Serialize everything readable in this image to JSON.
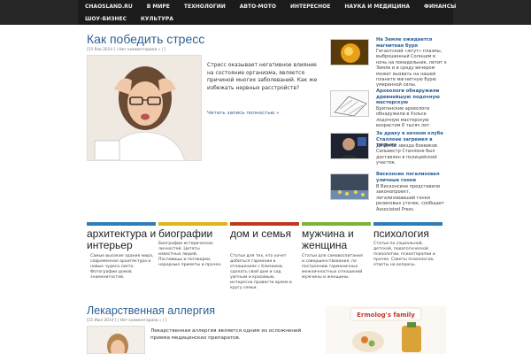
{
  "nav": {
    "row1": [
      "CHAOSLAND.RU",
      "В МИРЕ",
      "ТЕХНОЛОГИИ",
      "АВТО-МОТО",
      "ИНТЕРЕСНОЕ",
      "НАУКА И МЕДИЦИНА",
      "ФИНАНСЫ"
    ],
    "row2": [
      "ШОУ-БИЗНЕС",
      "КУЛЬТУРА"
    ]
  },
  "featured": {
    "title": "Как победить стресс",
    "meta": "[15 Янв 2014 ] | Нет комментариев » | ]",
    "excerpt": "Стресс оказывает негативное влияние на состояние организма, является причиной многих заболеваний. Как же избежать нервных расстройств?",
    "readmore": "Читать запись полностью »"
  },
  "news": [
    {
      "title": "На Земле ожидается магнитная буря",
      "text": "Гигантский «жгут» плазмы, выброшенный Солнцем в ночь на понедельник, летит к Земле и в среду вечером может вызвать на нашей планете магнитную бурю умеренной силы."
    },
    {
      "title": "Археологи обнаружили древнейшую лодочную мастерскую",
      "text": "Британские археологи обнаружили в Уэльсе лодочную мастерскую возрастом 6 тысяч лет."
    },
    {
      "title": "За драку в ночном клубе Сталлоне загремел в тюрьму",
      "text": "Ди Джей звезда боевиков Сильвестр Сталлоне был доставлен в полицейский участок."
    },
    {
      "title": "Висконсин легализовал уличные гонки",
      "text": "В Висконсине представили законопроект, легализовавший гонки резиновых уточек, сообщает Associated Press."
    }
  ],
  "categories": [
    {
      "title": "архитектура и интерьер",
      "text": "Самые высокие здания мира, современная архитектура и новые чудеса света. Фотографии домов знаменитостей.",
      "color": "#2e7db8"
    },
    {
      "title": "биографии",
      "text": "Биографии исторических личностей. Цитаты известных людей. Пословицы и поговорки, народные приметы и прочее.",
      "color": "#e2b31a"
    },
    {
      "title": "дом и семья",
      "text": "Статьи для тех, кто хочет добиться гармонии в отношениях с близкими, сделать свой дом и сад уютным и красивым, интересно провести время в кругу семьи.",
      "color": "#c0391f"
    },
    {
      "title": "мужчина и женщина",
      "text": "Статьи для самовоспитания и совершенствования, по построению гармоничных межличностных отношений мужчины и женщины.",
      "color": "#7bb338"
    },
    {
      "title": "психология",
      "text": "Статьи по социальной, детской, педагогической психологии, психотерапии и прочее. Советы психологов, ответы на вопросы.",
      "color": "#2e7db8"
    }
  ],
  "second_post": {
    "title": "Лекарственная аллергия",
    "meta": "[15 Июл 2014 ] | Нет комментариев » | ]",
    "excerpt": "Лекарственная аллергия является одним из осложнений приема медицинских препаратов."
  },
  "ad": {
    "brand": "Ermolog's family"
  }
}
